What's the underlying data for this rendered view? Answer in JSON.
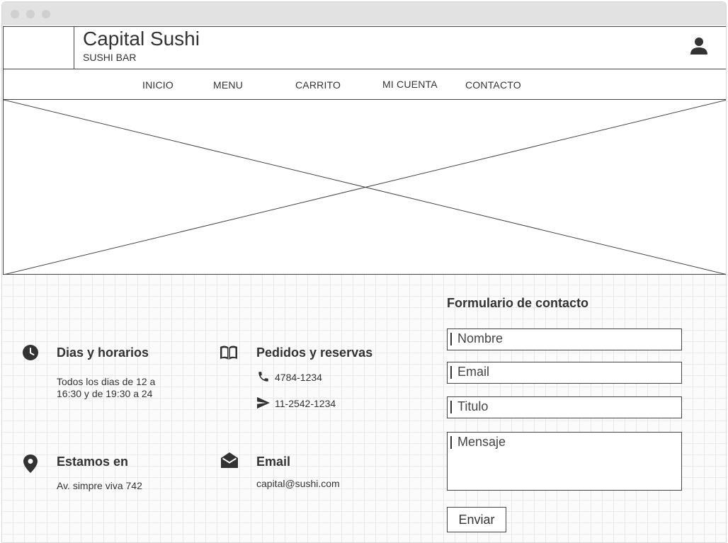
{
  "header": {
    "brand_title": "Capital Sushi",
    "brand_subtitle": "SUSHI BAR",
    "user_icon": "user-icon"
  },
  "nav": {
    "items": [
      {
        "label": "INICIO"
      },
      {
        "label": "MENU"
      },
      {
        "label": "CARRITO"
      },
      {
        "label": "MI CUENTA"
      },
      {
        "label": "CONTACTO"
      }
    ]
  },
  "info": {
    "hours": {
      "icon": "clock-icon",
      "title": "Dias y horarios",
      "line1": "Todos los dias de 12 a",
      "line2": "16:30 y de 19:30 a 24"
    },
    "orders": {
      "icon": "book-icon",
      "title": "Pedidos y reservas",
      "phone": "4784-1234",
      "mobile": "11-2542-1234",
      "phone_icon": "phone-icon",
      "mobile_icon": "send-icon"
    },
    "location": {
      "icon": "location-pin-icon",
      "title": "Estamos en",
      "address": "Av. simpre viva 742"
    },
    "email": {
      "icon": "envelope-open-icon",
      "title": "Email",
      "address": "capital@sushi.com"
    }
  },
  "form": {
    "title": "Formulario de contacto",
    "name_placeholder": "Nombre",
    "email_placeholder": "Email",
    "subject_placeholder": "Titulo",
    "message_placeholder": "Mensaje",
    "submit_label": "Enviar"
  }
}
